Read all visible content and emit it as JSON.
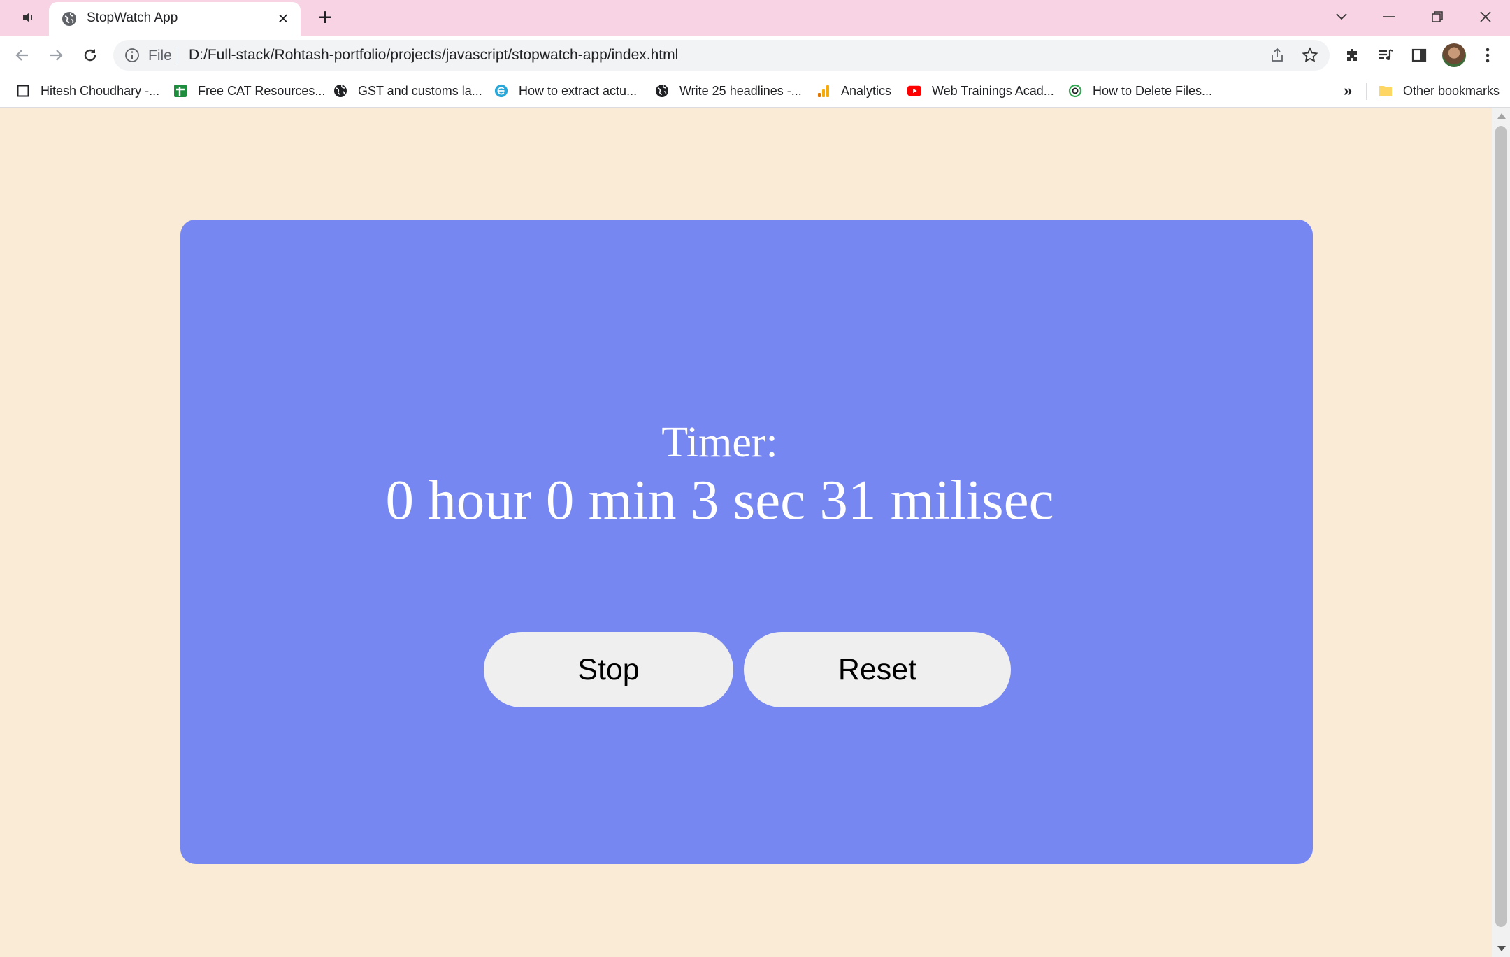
{
  "browser": {
    "tab": {
      "title": "StopWatch App"
    },
    "omnibox": {
      "scheme_label": "File",
      "url": "D:/Full-stack/Rohtash-portfolio/projects/javascript/stopwatch-app/index.html"
    },
    "bookmarks": [
      {
        "label": "Hitesh Choudhary -...",
        "icon": "square-outline-icon"
      },
      {
        "label": "Free CAT Resources...",
        "icon": "sheets-icon"
      },
      {
        "label": "GST and customs la...",
        "icon": "globe-icon"
      },
      {
        "label": "How to extract actu...",
        "icon": "e-logo-icon"
      },
      {
        "label": "Write 25 headlines -...",
        "icon": "globe-icon"
      },
      {
        "label": "Analytics",
        "icon": "analytics-icon"
      },
      {
        "label": "Web Trainings Acad...",
        "icon": "youtube-icon"
      },
      {
        "label": "How to Delete Files...",
        "icon": "green-c-icon"
      }
    ],
    "more_bookmarks": "»",
    "other_bookmarks": "Other bookmarks"
  },
  "page": {
    "timer_label": "Timer:",
    "timer_value": "0 hour 0 min 3 sec 31 milisec",
    "stop_button": "Stop",
    "reset_button": "Reset"
  },
  "colors": {
    "tabstrip_bg": "#f7d3e3",
    "page_bg": "#faebd7",
    "card_bg": "#7687f2",
    "button_bg": "#efefef"
  }
}
